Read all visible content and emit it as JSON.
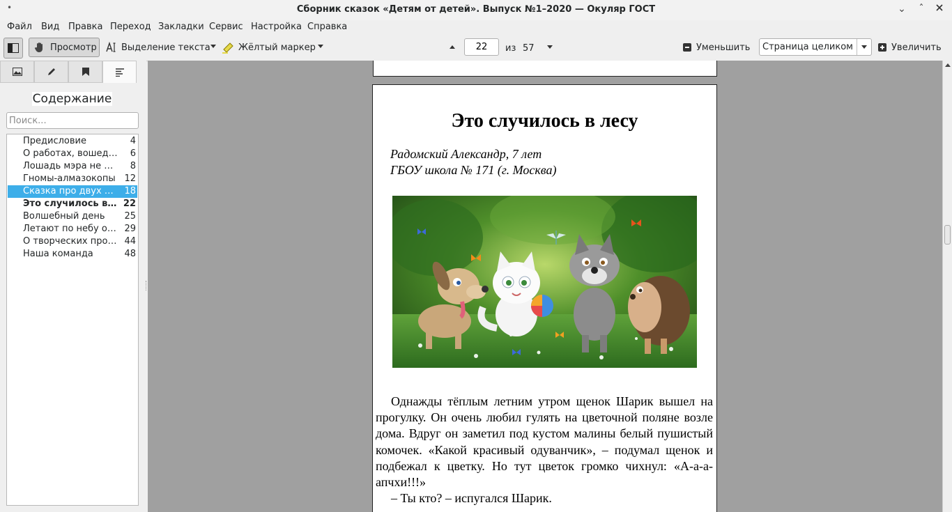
{
  "window": {
    "title": "Сборник сказок «Детям от детей». Выпуск №1–2020  — Окуляр ГОСТ"
  },
  "menu": [
    "Файл",
    "Вид",
    "Правка",
    "Переход",
    "Закладки",
    "Сервис",
    "Настройка",
    "Справка"
  ],
  "toolbar": {
    "browse_label": "Просмотр",
    "select_label": "Выделение текста",
    "marker_label": "Жёлтый маркер",
    "page_current": "22",
    "page_of": "из",
    "page_total": "57",
    "zoom_out_label": "Уменьшить",
    "zoom_mode": "Страница целиком",
    "zoom_in_label": "Увеличить"
  },
  "sidebar": {
    "tabs": [
      "thumbnails-icon",
      "annotations-icon",
      "bookmarks-icon",
      "contents-icon"
    ],
    "title": "Содержание",
    "search_placeholder": "Поиск...",
    "toc": [
      {
        "label": "Предисловие",
        "page": "4"
      },
      {
        "label": "О работах, вошедших в сборник",
        "page": "6"
      },
      {
        "label": "Лошадь мэра не виновата",
        "page": "8"
      },
      {
        "label": "Гномы-алмазокопы",
        "page": "12"
      },
      {
        "label": "Сказка про двух маленьких друзей",
        "page": "18"
      },
      {
        "label": "Это случилось в лесу",
        "page": "22"
      },
      {
        "label": "Волшебный день",
        "page": "25"
      },
      {
        "label": "Летают по небу олени",
        "page": "29"
      },
      {
        "label": "О творческих программах",
        "page": "44"
      },
      {
        "label": "Наша команда",
        "page": "48"
      }
    ]
  },
  "document": {
    "story_title": "Это случилось в лесу",
    "author_line1": "Радомский Александр, 7 лет",
    "author_line2": "ГБОУ школа № 171 (г. Москва)",
    "paragraph1": "Однажды тёплым летним утром щенок Шарик вышел на прогулку. Он очень любил гулять на цветочной поляне возле дома. Вдруг он заметил под кустом малины белый пушистый комочек. «Какой красивый одуванчик», – подумал щенок и подбежал к цветку. Но тут цветок громко чихнул: «А-а-а-апчхи!!!»",
    "paragraph2": "– Ты кто? – испугался Шарик."
  },
  "colors": {
    "selection": "#3daee9",
    "viewer_bg": "#a0a0a0"
  }
}
